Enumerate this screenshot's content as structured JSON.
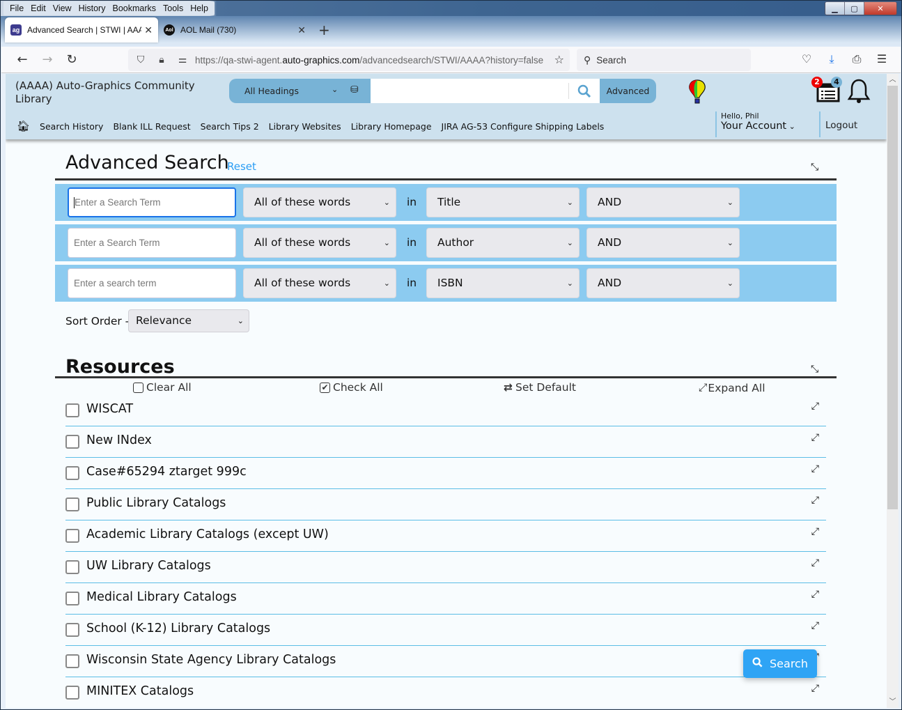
{
  "browser": {
    "menu": [
      "File",
      "Edit",
      "View",
      "History",
      "Bookmarks",
      "Tools",
      "Help"
    ],
    "tabs": [
      {
        "title": "Advanced Search | STWI | AAAA",
        "active": true
      },
      {
        "title": "AOL Mail (730)",
        "active": false
      }
    ],
    "url_prefix": "https://qa-stwi-agent.",
    "url_domain": "auto-graphics.com",
    "url_suffix": "/advancedsearch/STWI/AAAA?history=false",
    "search_placeholder": "Search"
  },
  "header": {
    "library_name": "(AAAA) Auto-Graphics Community Library",
    "heading_select": "All Headings",
    "search_value": "",
    "advanced_label": "Advanced",
    "badge_red": "2",
    "badge_blue": "4",
    "nav": [
      "Search History",
      "Blank ILL Request",
      "Search Tips 2",
      "Library Websites",
      "Library Homepage",
      "JIRA AG-53 Configure Shipping Labels"
    ],
    "greeting": "Hello, Phil",
    "account_label": "Your Account",
    "logout_label": "Logout"
  },
  "advanced": {
    "title": "Advanced Search",
    "reset_label": "Reset",
    "in_label": "in",
    "rows": [
      {
        "placeholder": "Enter a Search Term",
        "match": "All of these words",
        "field": "Title",
        "op": "AND"
      },
      {
        "placeholder": "Enter a Search Term",
        "match": "All of these words",
        "field": "Author",
        "op": "AND"
      },
      {
        "placeholder": "Enter a search term",
        "match": "All of these words",
        "field": "ISBN",
        "op": "AND"
      }
    ],
    "sort_label": "Sort Order -",
    "sort_value": "Relevance"
  },
  "resources": {
    "title": "Resources",
    "clear_all": "Clear All",
    "check_all": "Check All",
    "set_default": "Set Default",
    "expand_all": "Expand All",
    "items": [
      "WISCAT",
      "New INdex",
      "Case#65294 ztarget 999c",
      "Public Library Catalogs",
      "Academic Library Catalogs (except UW)",
      "UW Library Catalogs",
      "Medical Library Catalogs",
      "School (K-12) Library Catalogs",
      "Wisconsin State Agency Library Catalogs",
      "MINITEX Catalogs"
    ]
  },
  "search_button": "Search",
  "colors": {
    "header_bg": "#cde1ee",
    "search_accent": "#78b3d6",
    "row_bg": "#8ccbf0",
    "link": "#2a9df4",
    "search_button": "#2fa4f5",
    "divider": "#5bbde6"
  }
}
